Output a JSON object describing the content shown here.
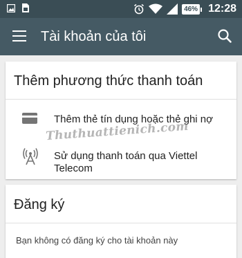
{
  "status_bar": {
    "battery": "46%",
    "time": "12:28",
    "icons": [
      "image-icon",
      "sim-icon",
      "alarm-icon",
      "wifi-icon",
      "signal-icon",
      "battery-icon"
    ]
  },
  "app_bar": {
    "title": "Tài khoản của tôi",
    "menu_icon": "menu-icon",
    "search_icon": "search-icon"
  },
  "payment_card": {
    "title": "Thêm phương thức thanh toán",
    "options": [
      {
        "label": "Thêm thẻ tín dụng hoặc thẻ ghi nợ",
        "icon": "credit-card-icon"
      },
      {
        "label": "Sử dụng thanh toán qua Viettel Telecom",
        "icon": "antenna-icon"
      }
    ]
  },
  "subscription_card": {
    "title": "Đăng ký",
    "empty_text": "Bạn không có đăng ký cho tài khoản này"
  },
  "watermark": "Thuthuattienich.com",
  "colors": {
    "status_bar": "#3a4d55",
    "app_bar": "#455a64",
    "background": "#eeeeee",
    "card": "#ffffff"
  }
}
